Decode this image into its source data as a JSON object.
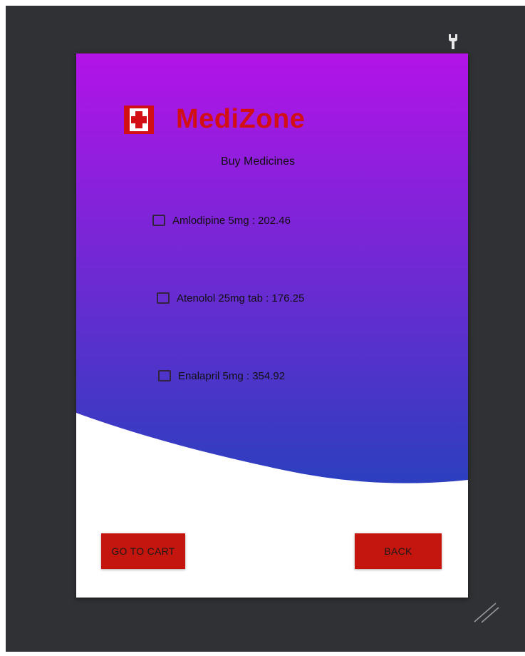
{
  "app": {
    "name": "MediZone",
    "subtitle": "Buy Medicines"
  },
  "colors": {
    "brand_red": "#d10f14",
    "button_red": "#c4150e",
    "gradient_top": "#b313e8",
    "gradient_bottom": "#2c3fbf",
    "frame": "#2f3134"
  },
  "icons": {
    "logo": "medical-cross-icon",
    "top_right": "wrench-icon",
    "bottom_right": "resize-grip-icon"
  },
  "medicines": [
    {
      "label": "Amlodipine 5mg : 202.46",
      "checked": false
    },
    {
      "label": "Atenolol 25mg tab : 176.25",
      "checked": false
    },
    {
      "label": "Enalapril 5mg : 354.92",
      "checked": false
    }
  ],
  "buttons": {
    "cart": "GO TO CART",
    "back": "BACK"
  }
}
